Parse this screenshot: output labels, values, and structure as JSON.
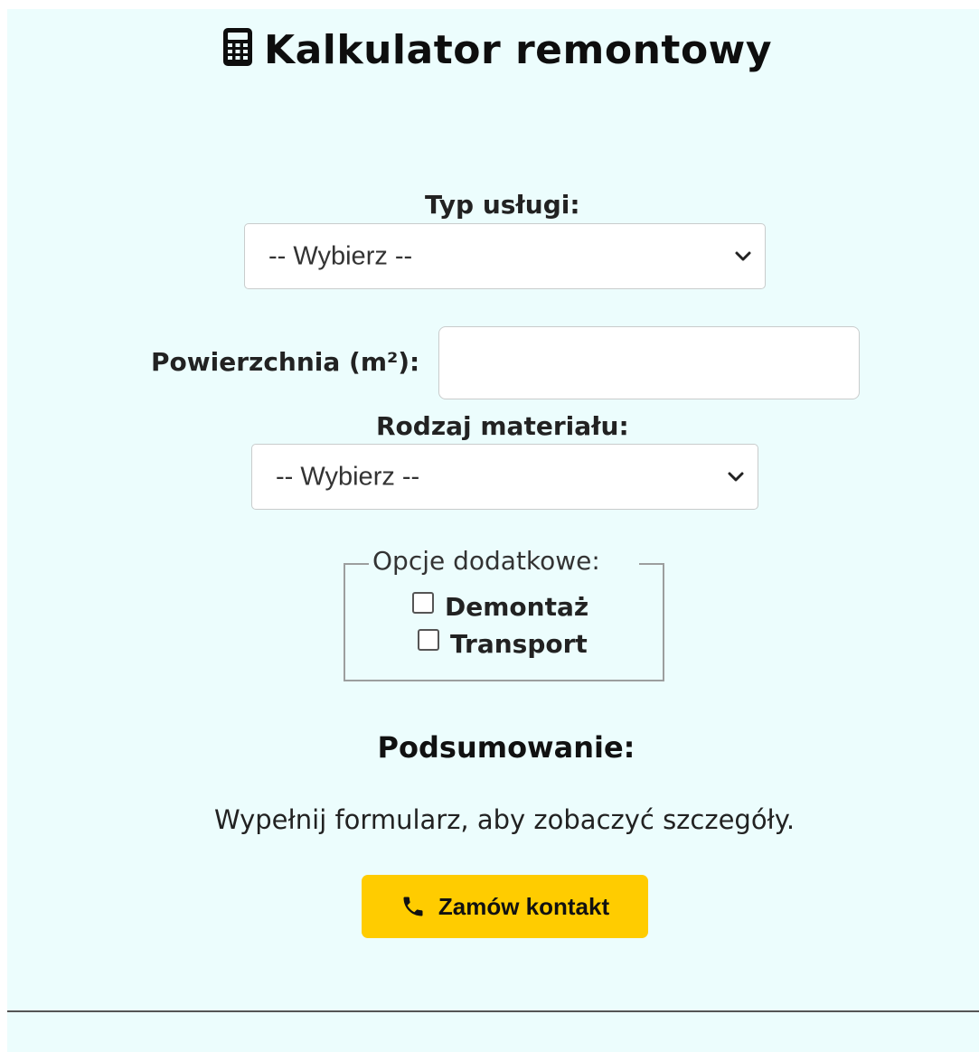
{
  "header": {
    "title": "Kalkulator remontowy",
    "icon": "calculator-icon"
  },
  "form": {
    "service_type": {
      "label": "Typ usługi:",
      "selected": "-- Wybierz --"
    },
    "area": {
      "label": "Powierzchnia (m²):",
      "value": ""
    },
    "material": {
      "label": "Rodzaj materiału:",
      "selected": "-- Wybierz --"
    },
    "extras": {
      "legend": "Opcje dodatkowe:",
      "options": [
        {
          "label": "Demontaż",
          "checked": false
        },
        {
          "label": "Transport",
          "checked": false
        }
      ]
    }
  },
  "summary": {
    "title": "Podsumowanie:",
    "text": "Wypełnij formularz, aby zobaczyć szczegóły."
  },
  "cta": {
    "label": "Zamów kontakt",
    "icon": "phone-icon",
    "color": "#ffcc00"
  },
  "colors": {
    "background": "#ecfdfd",
    "accent": "#ffcc00"
  }
}
